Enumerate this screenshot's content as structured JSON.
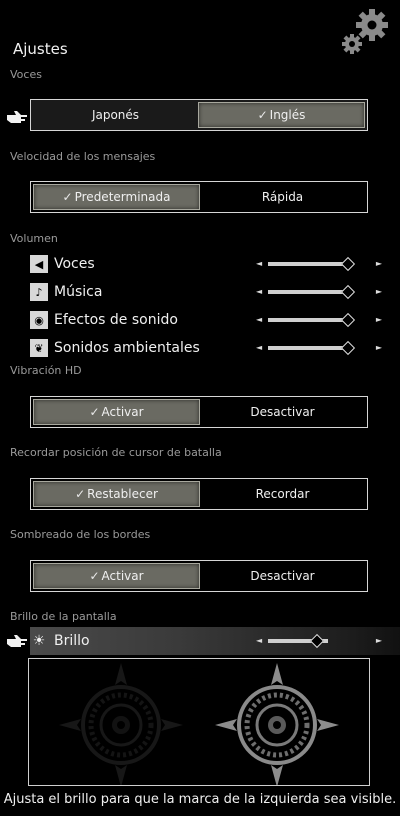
{
  "header": {
    "title": "Ajustes"
  },
  "voices": {
    "label": "Voces",
    "options": [
      "Japonés",
      "Inglés"
    ],
    "selected": "Inglés"
  },
  "message_speed": {
    "label": "Velocidad de los mensajes",
    "options": [
      "Predeterminada",
      "Rápida"
    ],
    "selected": "Predeterminada"
  },
  "volume": {
    "label": "Volumen",
    "items": [
      {
        "label": "Voces",
        "icon": "voice-icon",
        "level": 1.0
      },
      {
        "label": "Música",
        "icon": "music-note-icon",
        "level": 1.0
      },
      {
        "label": "Efectos de sonido",
        "icon": "sound-effects-icon",
        "level": 1.0
      },
      {
        "label": "Sonidos ambientales",
        "icon": "leaf-icon",
        "level": 1.0
      }
    ]
  },
  "hd_vibration": {
    "label": "Vibración HD",
    "options": [
      "Activar",
      "Desactivar"
    ],
    "selected": "Activar"
  },
  "cursor_memory": {
    "label": "Recordar posición de cursor de batalla",
    "options": [
      "Restablecer",
      "Recordar"
    ],
    "selected": "Restablecer"
  },
  "edge_shading": {
    "label": "Sombreado de los bordes",
    "options": [
      "Activar",
      "Desactivar"
    ],
    "selected": "Activar"
  },
  "screen_brightness": {
    "label": "Brillo de la pantalla",
    "item_label": "Brillo",
    "icon": "sun-icon",
    "level": 0.75,
    "hint": "Ajusta el brillo para que la marca de la izquierda sea visible."
  },
  "colors": {
    "selected_fill": "#6a6a62",
    "background": "#000000",
    "section_label": "#9a9a9a"
  }
}
